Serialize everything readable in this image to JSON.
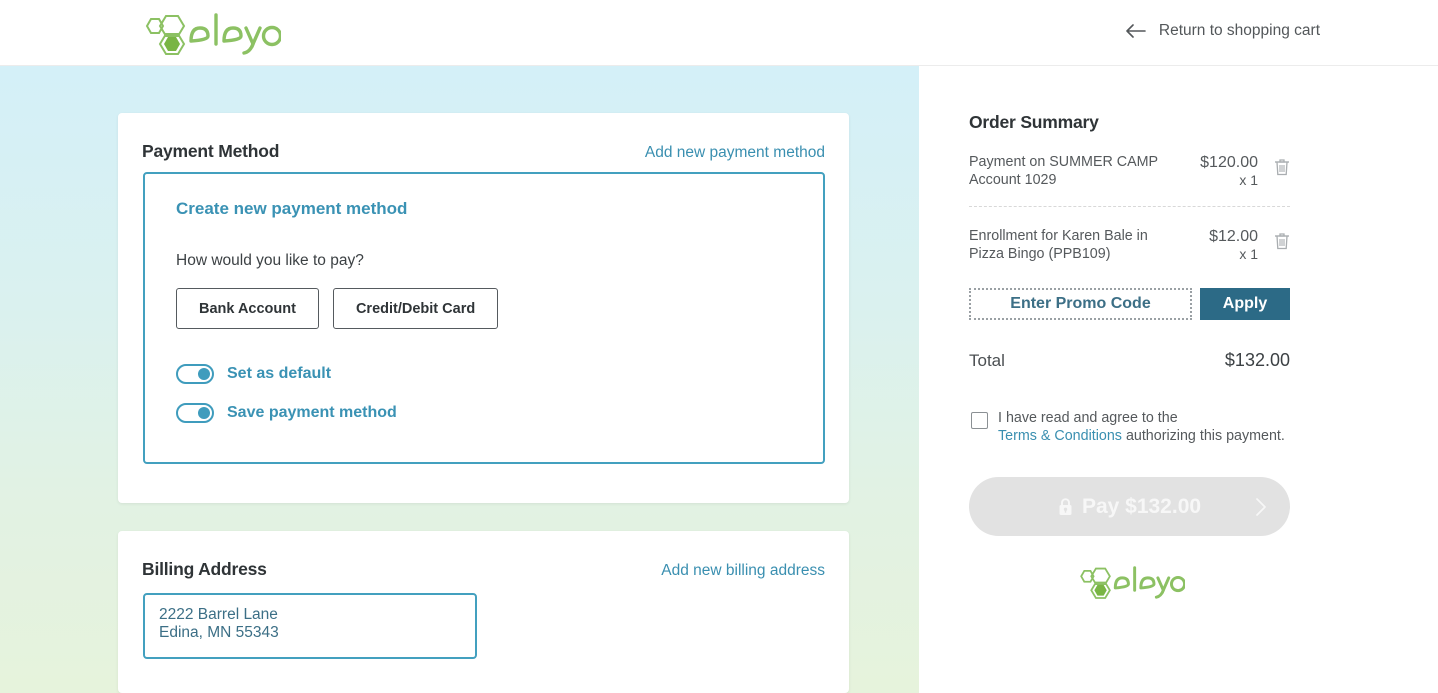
{
  "header": {
    "logo_text": "eleyo",
    "return_link": "Return to shopping cart",
    "return_icon": "arrow-left-icon"
  },
  "payment_method": {
    "title": "Payment Method",
    "add_link": "Add new payment method",
    "create_title": "Create new payment method",
    "question": "How would you like to pay?",
    "type_buttons": [
      {
        "label": "Bank Account"
      },
      {
        "label": "Credit/Debit Card"
      }
    ],
    "toggles": [
      {
        "label": "Set as default",
        "state": "on"
      },
      {
        "label": "Save payment method",
        "state": "on"
      }
    ]
  },
  "billing_address": {
    "title": "Billing Address",
    "add_link": "Add new billing address",
    "selected": {
      "line1": "2222 Barrel Lane",
      "line2": "Edina, MN 55343"
    }
  },
  "order_summary": {
    "title": "Order Summary",
    "items": [
      {
        "description": "Payment on SUMMER CAMP Account 1029",
        "amount": "$120.00",
        "quantity": "x 1",
        "delete_icon": "trash-icon"
      },
      {
        "description": "Enrollment for Karen Bale in Pizza Bingo (PPB109)",
        "amount": "$12.00",
        "quantity": "x 1",
        "delete_icon": "trash-icon"
      }
    ],
    "promo": {
      "placeholder": "Enter Promo Code",
      "value": "",
      "apply_label": "Apply"
    },
    "total_label": "Total",
    "total_value": "$132.00",
    "terms": {
      "text_before": "I have read and agree to the",
      "link": "Terms & Conditions",
      "text_after": "authorizing this payment.",
      "checked": false
    },
    "pay_button": {
      "label": "Pay $132.00",
      "lock_icon": "lock-icon",
      "chevron_icon": "chevron-right-icon",
      "disabled": true
    },
    "footer_logo_text": "eleyo"
  },
  "colors": {
    "teal": "#43a0bf",
    "teal_link": "#3a8fb0",
    "teal_dark": "#2c6a86",
    "green_logo": "#7db853",
    "gradient_top": "#d4f0f8",
    "gradient_bottom": "#e6f3dc",
    "disabled_button": "#e2e2e2"
  }
}
